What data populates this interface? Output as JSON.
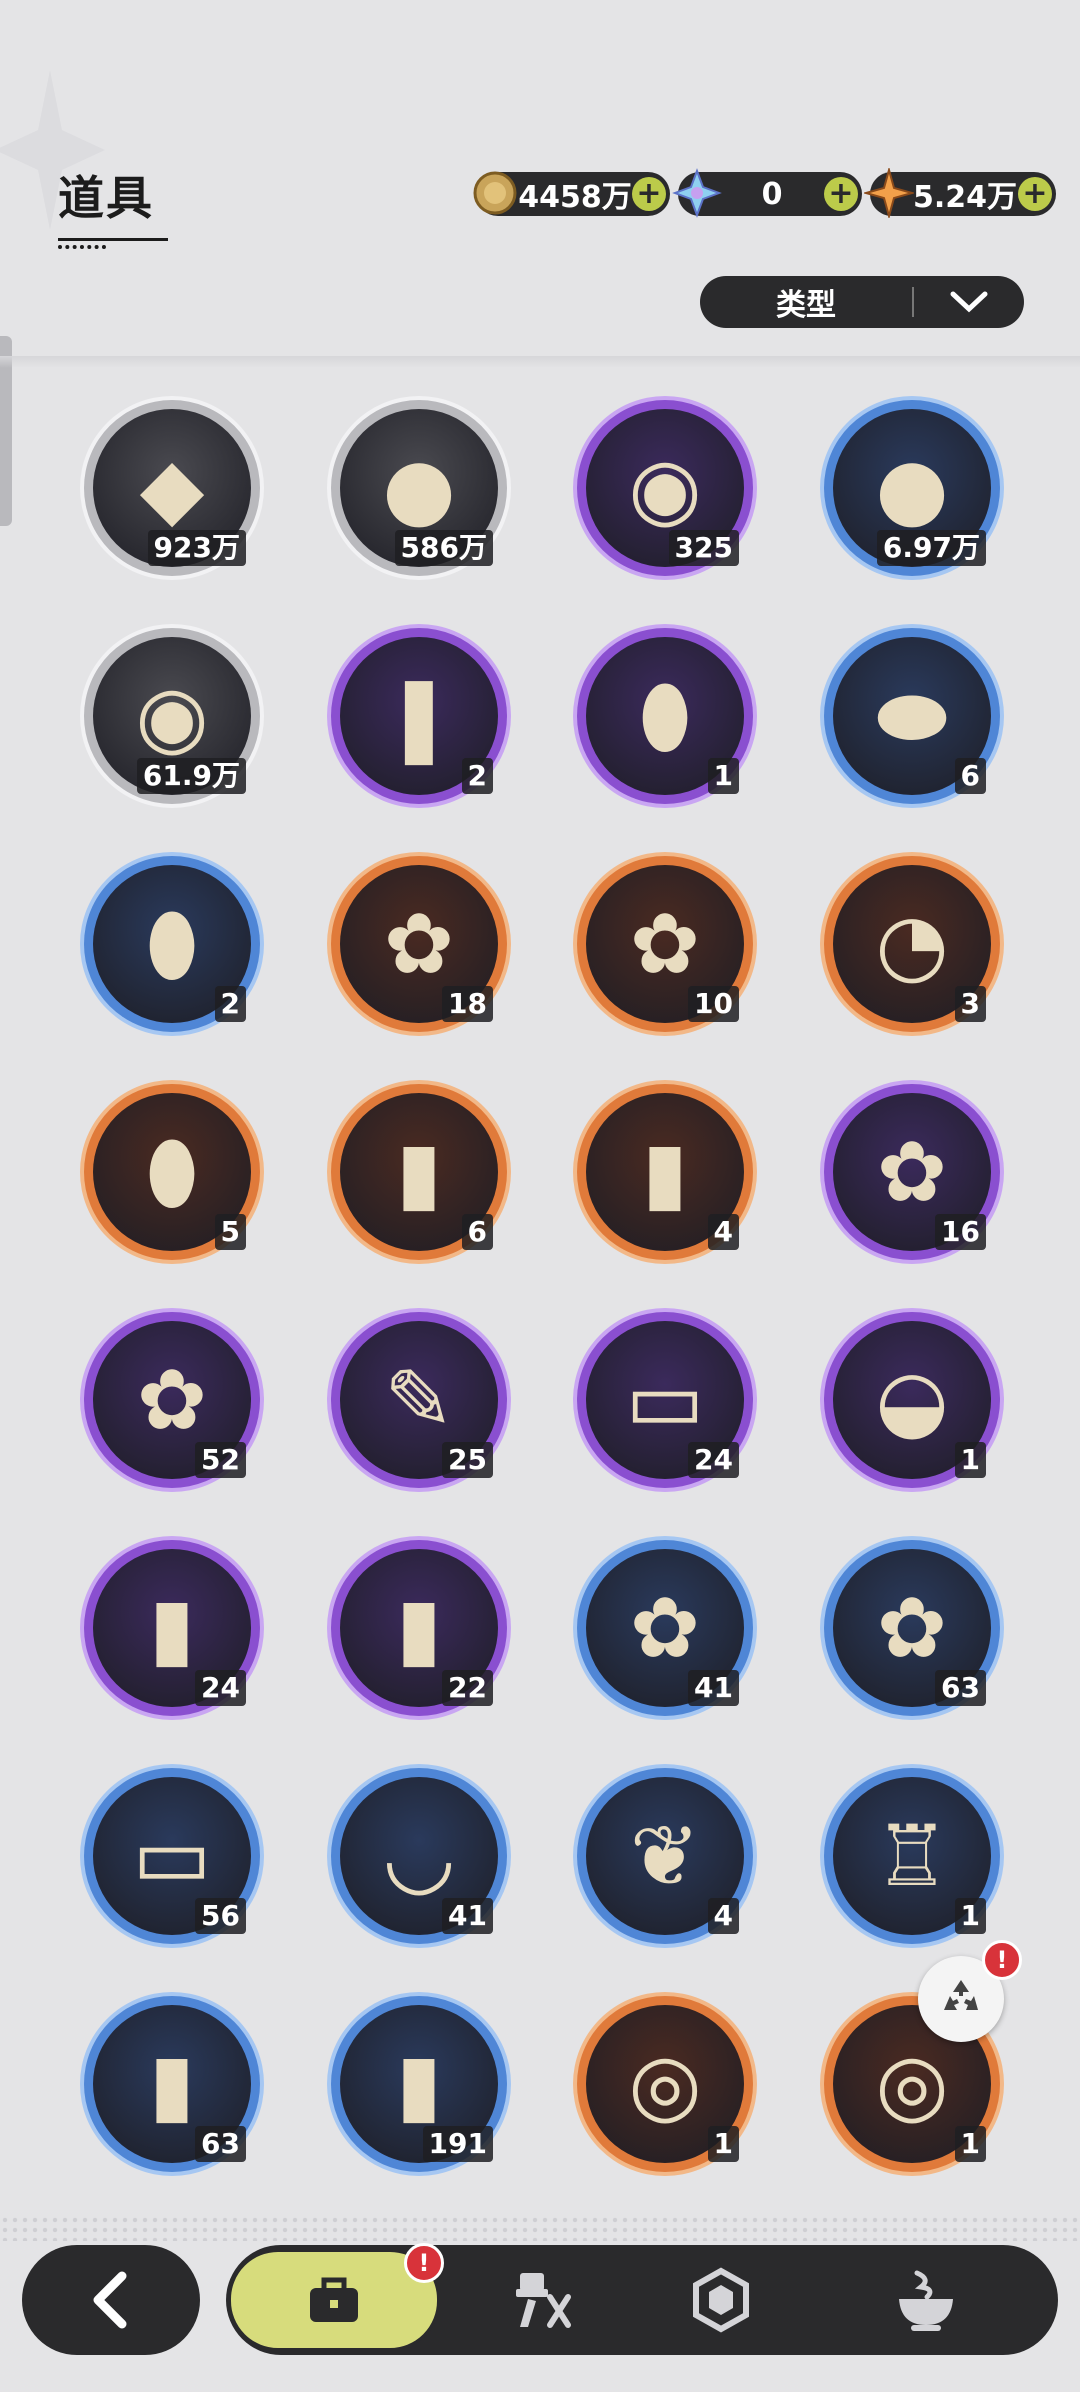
{
  "header": {
    "title": "道具"
  },
  "currencies": [
    {
      "icon": "gold-coin-icon",
      "value": "4458万"
    },
    {
      "icon": "crystal-gem-icon",
      "value": "0"
    },
    {
      "icon": "star-shard-icon",
      "value": "5.24万"
    }
  ],
  "filter": {
    "label": "类型"
  },
  "items": [
    {
      "icon": "dark-crystal-icon",
      "rarity": "gray",
      "count": "923万"
    },
    {
      "icon": "purple-orb-icon",
      "rarity": "gray",
      "count": "586万"
    },
    {
      "icon": "pink-paw-sack-icon",
      "rarity": "purple",
      "count": "325"
    },
    {
      "icon": "blue-paw-sack-icon",
      "rarity": "blue",
      "count": "6.97万"
    },
    {
      "icon": "brown-paw-sack-icon",
      "rarity": "gray",
      "count": "61.9万"
    },
    {
      "icon": "bundle-icon",
      "rarity": "purple",
      "count": "2"
    },
    {
      "icon": "amber-bottle-icon",
      "rarity": "purple",
      "count": "1"
    },
    {
      "icon": "egg-icon",
      "rarity": "blue",
      "count": "6"
    },
    {
      "icon": "potion-vial-icon",
      "rarity": "blue",
      "count": "2"
    },
    {
      "icon": "pink-bouquet-icon",
      "rarity": "orange",
      "count": "18"
    },
    {
      "icon": "violet-bouquet-icon",
      "rarity": "orange",
      "count": "10"
    },
    {
      "icon": "pocket-watch-icon",
      "rarity": "orange",
      "count": "3"
    },
    {
      "icon": "green-potion-icon",
      "rarity": "orange",
      "count": "5"
    },
    {
      "icon": "crane-book-icon",
      "rarity": "orange",
      "count": "6"
    },
    {
      "icon": "golden-book-icon",
      "rarity": "orange",
      "count": "4"
    },
    {
      "icon": "blossom-bouquet-icon",
      "rarity": "purple",
      "count": "16"
    },
    {
      "icon": "white-bouquet-icon",
      "rarity": "purple",
      "count": "52"
    },
    {
      "icon": "quill-ink-icon",
      "rarity": "purple",
      "count": "25"
    },
    {
      "icon": "pillow-icon",
      "rarity": "purple",
      "count": "24"
    },
    {
      "icon": "gold-ingot-icon",
      "rarity": "purple",
      "count": "1"
    },
    {
      "icon": "red-tome-icon",
      "rarity": "purple",
      "count": "24"
    },
    {
      "icon": "sword-tome-icon",
      "rarity": "purple",
      "count": "22"
    },
    {
      "icon": "iris-bouquet-icon",
      "rarity": "blue",
      "count": "41"
    },
    {
      "icon": "sunflower-bouquet-icon",
      "rarity": "blue",
      "count": "63"
    },
    {
      "icon": "towel-icon",
      "rarity": "blue",
      "count": "56"
    },
    {
      "icon": "teacup-icon",
      "rarity": "blue",
      "count": "41"
    },
    {
      "icon": "golden-leaf-icon",
      "rarity": "blue",
      "count": "4"
    },
    {
      "icon": "goblet-icon",
      "rarity": "blue",
      "count": "1"
    },
    {
      "icon": "sack-card-icon",
      "rarity": "blue",
      "count": "63"
    },
    {
      "icon": "forest-card-icon",
      "rarity": "blue",
      "count": "191"
    },
    {
      "icon": "constellation-orb-icon",
      "rarity": "orange",
      "count": "1"
    },
    {
      "icon": "constellation-orb-icon",
      "rarity": "orange",
      "count": "1"
    }
  ],
  "recycle": {
    "icon": "recycle-icon",
    "badge": "!"
  },
  "nav": {
    "back_icon": "back-arrow-icon",
    "items": [
      {
        "icon": "bag-icon",
        "active": true,
        "badge": "!"
      },
      {
        "icon": "equipment-icon",
        "active": false
      },
      {
        "icon": "hexagon-icon",
        "active": false
      },
      {
        "icon": "cauldron-icon",
        "active": false
      }
    ]
  },
  "colors": {
    "gray": "#9a9aa0",
    "purple": "#8a4fd0",
    "blue": "#4f86d6",
    "orange": "#e07a3a",
    "accent": "#d7dc7c"
  }
}
